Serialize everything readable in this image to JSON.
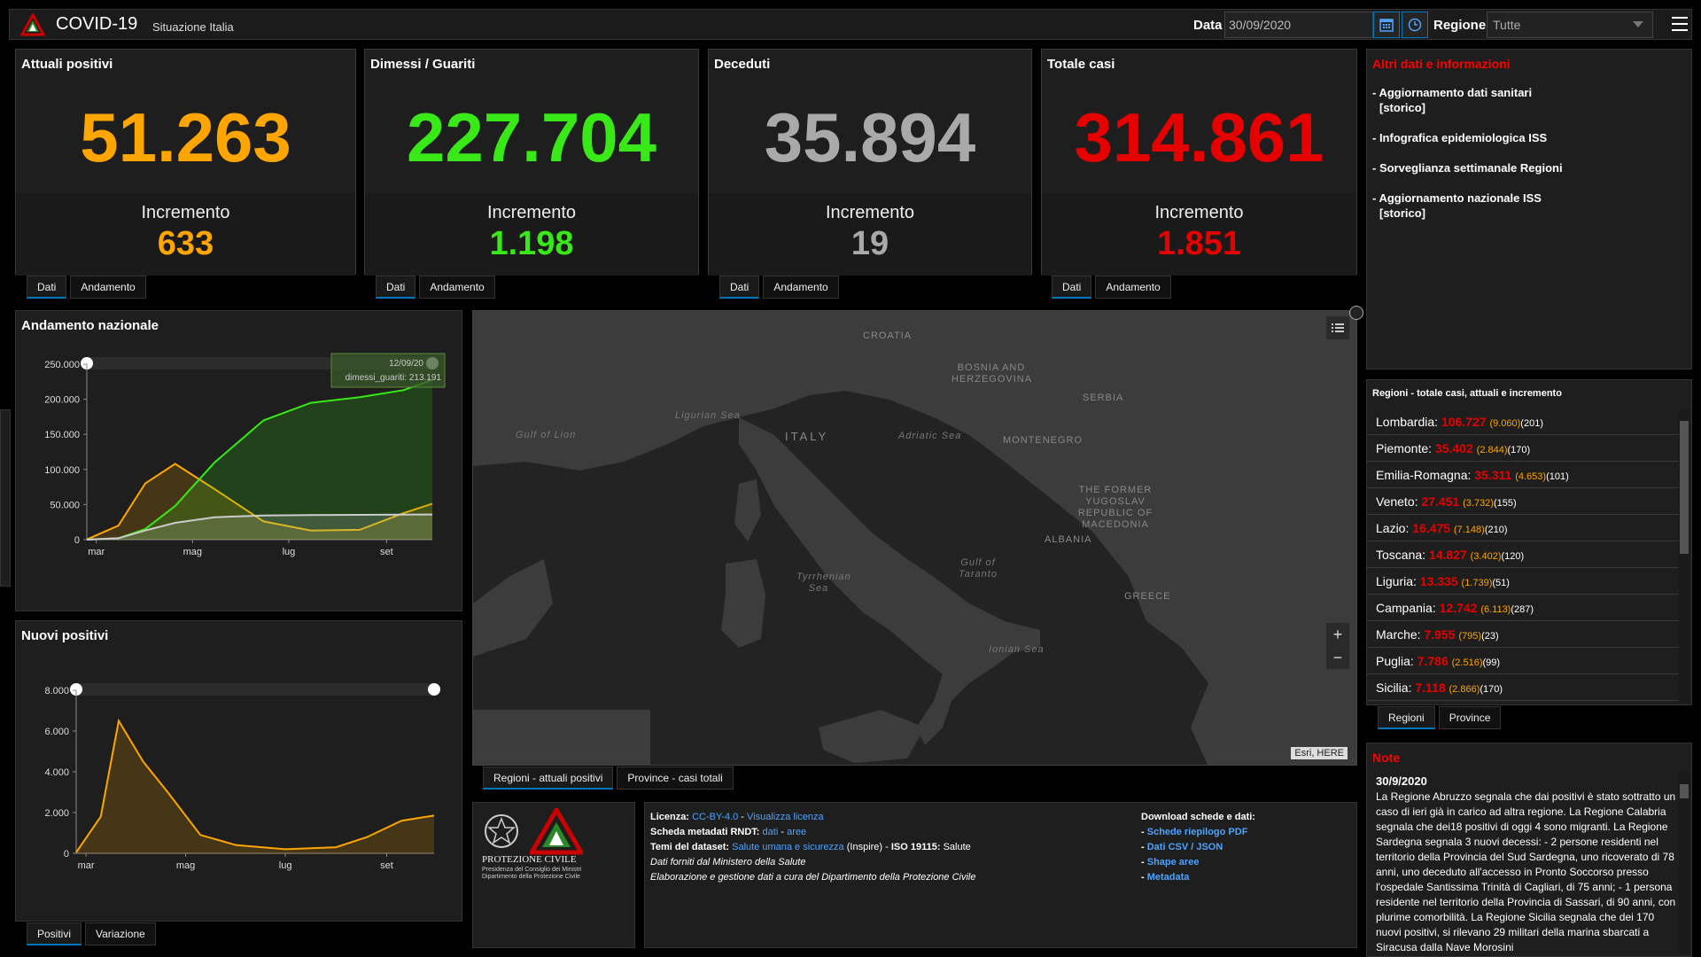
{
  "header": {
    "title": "COVID-19",
    "subtitle": "Situazione Italia",
    "date_label": "Data",
    "date_value": "30/09/2020",
    "region_label": "Regione",
    "region_value": "Tutte"
  },
  "kpis": [
    {
      "title": "Attuali positivi",
      "value": "51.263",
      "inc_label": "Incremento",
      "inc_value": "633",
      "color": "#ffa500"
    },
    {
      "title": "Dimessi / Guariti",
      "value": "227.704",
      "inc_label": "Incremento",
      "inc_value": "1.198",
      "color": "#38e817"
    },
    {
      "title": "Deceduti",
      "value": "35.894",
      "inc_label": "Incremento",
      "inc_value": "19",
      "color": "#a9a9a9"
    },
    {
      "title": "Totale casi",
      "value": "314.861",
      "inc_label": "Incremento",
      "inc_value": "1.851",
      "color": "#e60000"
    }
  ],
  "kpi_tabs": {
    "dati": "Dati",
    "andamento": "Andamento"
  },
  "info": {
    "title": "Altri dati e informazioni",
    "items": [
      {
        "label": "- Aggiornamento dati sanitari",
        "extra": "[storico]"
      },
      {
        "label": "- Infografica epidemiologica ISS",
        "extra": ""
      },
      {
        "label": "- Sorveglianza settimanale Regioni",
        "extra": ""
      },
      {
        "label": "- Aggiornamento nazionale ISS",
        "extra": "[storico]"
      }
    ]
  },
  "regions": {
    "title": "Regioni - totale casi, attuali e incremento",
    "items": [
      {
        "name": "Lombardia:",
        "tot": "106.727",
        "att": "(9.060)",
        "inc": "(201)"
      },
      {
        "name": "Piemonte:",
        "tot": "35.402",
        "att": "(2.844)",
        "inc": "(170)"
      },
      {
        "name": "Emilia-Romagna:",
        "tot": "35.311",
        "att": "(4.653)",
        "inc": "(101)"
      },
      {
        "name": "Veneto:",
        "tot": "27.451",
        "att": "(3.732)",
        "inc": "(155)"
      },
      {
        "name": "Lazio:",
        "tot": "16.475",
        "att": "(7.148)",
        "inc": "(210)"
      },
      {
        "name": "Toscana:",
        "tot": "14.827",
        "att": "(3.402)",
        "inc": "(120)"
      },
      {
        "name": "Liguria:",
        "tot": "13.335",
        "att": "(1.739)",
        "inc": "(51)"
      },
      {
        "name": "Campania:",
        "tot": "12.742",
        "att": "(6.113)",
        "inc": "(287)"
      },
      {
        "name": "Marche:",
        "tot": "7.955",
        "att": "(795)",
        "inc": "(23)"
      },
      {
        "name": "Puglia:",
        "tot": "7.786",
        "att": "(2.516)",
        "inc": "(99)"
      },
      {
        "name": "Sicilia:",
        "tot": "7.118",
        "att": "(2.866)",
        "inc": "(170)"
      }
    ],
    "tabs": [
      "Regioni",
      "Province"
    ]
  },
  "note": {
    "title": "Note",
    "date": "30/9/2020",
    "text": "La Regione Abruzzo segnala che dai positivi è stato sottratto un caso di ieri già in carico ad altra regione. La Regione Calabria segnala che dei18 positivi di oggi 4 sono migranti. La Regione Sardegna segnala 3 nuovi decessi: - 2 persone residenti nel territorio della Provincia del Sud Sardegna, uno ricoverato di 78 anni, uno deceduto all'accesso in Pronto Soccorso presso l'ospedale Santissima Trinità di Cagliari, di 75 anni; - 1 persona residente nel territorio della Provincia di Sassari, di 90 anni, con plurime comorbilità. La Regione Sicilia segnala che dei 170 nuovi positivi, si rilevano 29 militari della marina sbarcati a Siracusa dalla Nave Morosini"
  },
  "chart_andamento": {
    "title": "Andamento nazionale",
    "yticks": [
      "250.000",
      "200.000",
      "150.000",
      "100.000",
      "50.000",
      "0"
    ],
    "xticks": [
      "mar",
      "mag",
      "lug",
      "set"
    ],
    "tooltip_date": "12/09/20",
    "tooltip_value": "dimessi_guariti: 213.191"
  },
  "chart_nuovi": {
    "title": "Nuovi positivi",
    "yticks": [
      "8.000",
      "6.000",
      "4.000",
      "2.000",
      "0"
    ],
    "xticks": [
      "mar",
      "mag",
      "lug",
      "set"
    ],
    "tabs": [
      "Positivi",
      "Variazione"
    ]
  },
  "chart_data": [
    {
      "type": "area",
      "title": "Andamento nazionale",
      "x": [
        "2020-02-24",
        "2020-03-15",
        "2020-04-01",
        "2020-04-20",
        "2020-05-15",
        "2020-06-15",
        "2020-07-15",
        "2020-08-15",
        "2020-09-12",
        "2020-09-30"
      ],
      "ylim": [
        0,
        250000
      ],
      "series": [
        {
          "name": "",
          "color": "#ffa500",
          "values": [
            200,
            20000,
            80000,
            108000,
            72000,
            26000,
            13000,
            14000,
            38000,
            51263
          ]
        },
        {
          "name": "dimessi_guariti",
          "color": "#38e817",
          "values": [
            0,
            2000,
            15000,
            48000,
            110000,
            170000,
            195000,
            203000,
            213191,
            227704
          ]
        },
        {
          "name": "",
          "color": "#cccccc",
          "values": [
            0,
            2000,
            13000,
            24000,
            32000,
            34500,
            35100,
            35400,
            35600,
            35894
          ]
        }
      ]
    },
    {
      "type": "area",
      "title": "Nuovi positivi",
      "x": [
        "2020-02-24",
        "2020-03-10",
        "2020-03-21",
        "2020-04-05",
        "2020-04-20",
        "2020-05-10",
        "2020-06-01",
        "2020-07-01",
        "2020-08-01",
        "2020-08-20",
        "2020-09-10",
        "2020-09-30"
      ],
      "ylim": [
        0,
        8000
      ],
      "series": [
        {
          "name": "",
          "color": "#ffa500",
          "values": [
            50,
            1800,
            6500,
            4500,
            3000,
            900,
            400,
            200,
            300,
            800,
            1600,
            1851
          ]
        }
      ]
    }
  ],
  "map": {
    "labels": [
      "Croatia",
      "Bosnia and Herzegovina",
      "Serbia",
      "Italy",
      "Montenegro",
      "The Former Yugoslav Republic of Macedonia",
      "Albania",
      "Greece"
    ],
    "seas": [
      "Ligurian Sea",
      "Gulf of Lion",
      "Adriatic Sea",
      "Tyrrhenian Sea",
      "Gulf of Taranto",
      "Ionian Sea"
    ],
    "attribution": "Esri, HERE",
    "tabs": [
      "Regioni - attuali positivi",
      "Province - casi totali"
    ]
  },
  "footer": {
    "org_name": "PROTEZIONE CIVILE",
    "org_sub1": "Presidenza del Consiglio dei Ministri",
    "org_sub2": "Dipartimento della Protezione Civile",
    "licenza_label": "Licenza:",
    "licenza_link": "CC-BY-4.0",
    "licenza_sep": " - ",
    "licenza_view": "Visualizza licenza",
    "scheda_label": "Scheda metadati RNDT:",
    "scheda_dati": "dati",
    "scheda_sep": " - ",
    "scheda_aree": "aree",
    "temi_label": "Temi del dataset:",
    "temi_link": "Salute umana e sicurezza",
    "temi_rest": " (Inspire) - ",
    "iso_label": "ISO 19115:",
    "iso_value": " Salute",
    "fonte": "Dati forniti dal Ministero della Salute",
    "elab": "Elaborazione e gestione dati a cura del Dipartimento della Protezione Civile",
    "dl_title": "Download schede e dati:",
    "dl_items": [
      "Schede riepilogo PDF",
      "Dati CSV / JSON",
      "Shape aree",
      "Metadata"
    ]
  }
}
